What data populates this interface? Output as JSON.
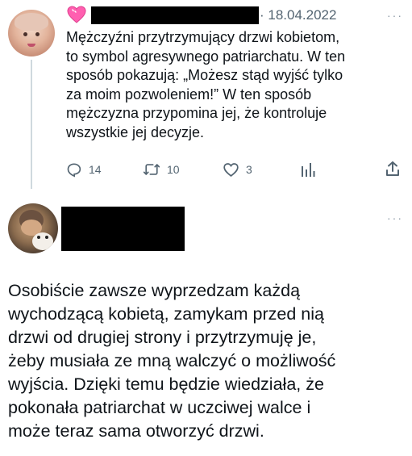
{
  "tweet1": {
    "badge_icon": "pink-heart-icon",
    "date": "· 18.04.2022",
    "more_label": "···",
    "text": "Mężczyźni przytrzymujący drzwi kobietom,\nto symbol agresywnego patriarchatu. W ten\nsposób pokazują: „Możesz stąd wyjść tylko\nza moim pozwoleniem!” W ten sposób\nmężczyzna przypomina jej, że kontroluje\nwszystkie jej decyzje.",
    "actions": {
      "replies": "14",
      "retweets": "10",
      "likes": "3"
    }
  },
  "tweet2": {
    "more_label": "···",
    "text": "Osobiście zawsze wyprzedzam każdą\nwychodzącą kobietą, zamykam przed nią\ndrzwi od drugiej strony i przytrzymuję je,\nżeby musiała ze mną walczyć o możliwość\nwyjścia. Dzięki temu będzie wiedziała, że\npokonała patriarchat w uczciwej walce i\nmoże teraz sama otworzyć drzwi."
  },
  "colors": {
    "text": "#0f1419",
    "secondary": "#536471",
    "heart": "#ff5fb0"
  }
}
